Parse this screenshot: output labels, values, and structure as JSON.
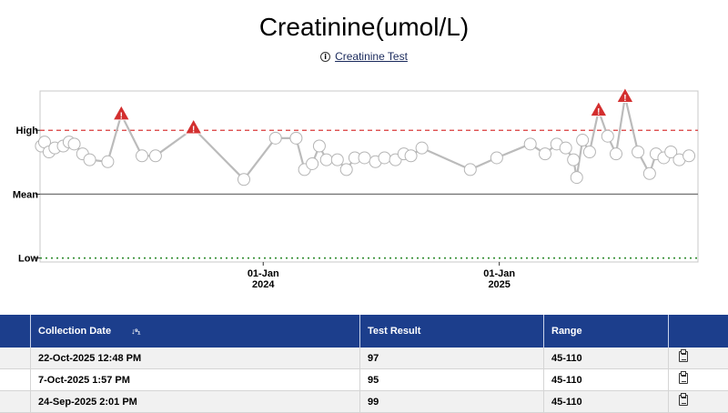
{
  "header": {
    "title": "Creatinine(umol/L)",
    "link_label": "Creatinine Test"
  },
  "chart_data": {
    "type": "line",
    "title": "Creatinine(umol/L)",
    "y_reference_labels": {
      "high": "High",
      "mean": "Mean",
      "low": "Low"
    },
    "reference_values": {
      "high": 110,
      "mean": 77.5,
      "low": 45
    },
    "ylim": [
      43,
      130
    ],
    "xlim": [
      "2023-01-20",
      "2025-11-05"
    ],
    "x_ticks": [
      {
        "date": "2024-01-01",
        "line1": "01-Jan",
        "line2": "2024"
      },
      {
        "date": "2025-01-01",
        "line1": "01-Jan",
        "line2": "2025"
      }
    ],
    "colors": {
      "high_line": "#d93a3a",
      "low_line": "#2e8b2e",
      "mean_line": "#777777",
      "series": "#bbbbbb",
      "alert": "#d32f2f"
    },
    "series": [
      {
        "values": [
          {
            "x": "2023-01-22",
            "y": 102
          },
          {
            "x": "2023-01-27",
            "y": 104
          },
          {
            "x": "2023-02-03",
            "y": 99
          },
          {
            "x": "2023-02-12",
            "y": 101
          },
          {
            "x": "2023-02-25",
            "y": 102
          },
          {
            "x": "2023-03-06",
            "y": 104
          },
          {
            "x": "2023-03-14",
            "y": 103
          },
          {
            "x": "2023-03-27",
            "y": 98
          },
          {
            "x": "2023-04-07",
            "y": 95
          },
          {
            "x": "2023-05-05",
            "y": 94
          },
          {
            "x": "2023-05-26",
            "y": 118,
            "alert": true
          },
          {
            "x": "2023-06-27",
            "y": 97
          },
          {
            "x": "2023-07-18",
            "y": 97
          },
          {
            "x": "2023-09-15",
            "y": 111,
            "alert": true
          },
          {
            "x": "2023-12-02",
            "y": 85
          },
          {
            "x": "2024-01-20",
            "y": 106
          },
          {
            "x": "2024-02-21",
            "y": 106
          },
          {
            "x": "2024-03-05",
            "y": 90
          },
          {
            "x": "2024-03-17",
            "y": 93
          },
          {
            "x": "2024-03-28",
            "y": 102
          },
          {
            "x": "2024-04-08",
            "y": 95
          },
          {
            "x": "2024-04-25",
            "y": 95
          },
          {
            "x": "2024-05-09",
            "y": 90
          },
          {
            "x": "2024-05-22",
            "y": 96
          },
          {
            "x": "2024-06-06",
            "y": 96
          },
          {
            "x": "2024-06-23",
            "y": 94
          },
          {
            "x": "2024-07-07",
            "y": 96
          },
          {
            "x": "2024-07-24",
            "y": 95
          },
          {
            "x": "2024-08-06",
            "y": 98
          },
          {
            "x": "2024-08-17",
            "y": 97
          },
          {
            "x": "2024-09-03",
            "y": 101
          },
          {
            "x": "2024-11-17",
            "y": 90
          },
          {
            "x": "2024-12-28",
            "y": 96
          },
          {
            "x": "2025-02-18",
            "y": 103
          },
          {
            "x": "2025-03-13",
            "y": 98
          },
          {
            "x": "2025-03-31",
            "y": 103
          },
          {
            "x": "2025-04-14",
            "y": 101
          },
          {
            "x": "2025-04-26",
            "y": 95
          },
          {
            "x": "2025-05-01",
            "y": 86
          },
          {
            "x": "2025-05-10",
            "y": 105
          },
          {
            "x": "2025-05-21",
            "y": 99
          },
          {
            "x": "2025-06-04",
            "y": 120,
            "alert": true
          },
          {
            "x": "2025-06-18",
            "y": 107
          },
          {
            "x": "2025-07-01",
            "y": 98
          },
          {
            "x": "2025-07-15",
            "y": 127,
            "alert": true
          },
          {
            "x": "2025-08-04",
            "y": 99
          },
          {
            "x": "2025-08-22",
            "y": 88
          },
          {
            "x": "2025-09-01",
            "y": 98
          },
          {
            "x": "2025-09-13",
            "y": 96
          },
          {
            "x": "2025-09-24",
            "y": 99
          },
          {
            "x": "2025-10-07",
            "y": 95
          },
          {
            "x": "2025-10-22",
            "y": 97
          }
        ]
      }
    ]
  },
  "table": {
    "columns": [
      "",
      "Collection Date",
      "Test Result",
      "Range",
      ""
    ],
    "rows": [
      {
        "date": "22-Oct-2025 12:48 PM",
        "result": "97",
        "range": "45-110",
        "icon": "clipboard-icon"
      },
      {
        "date": "7-Oct-2025 1:57 PM",
        "result": "95",
        "range": "45-110",
        "icon": "clipboard-icon"
      },
      {
        "date": "24-Sep-2025 2:01 PM",
        "result": "99",
        "range": "45-110",
        "icon": "clipboard-icon"
      }
    ]
  }
}
